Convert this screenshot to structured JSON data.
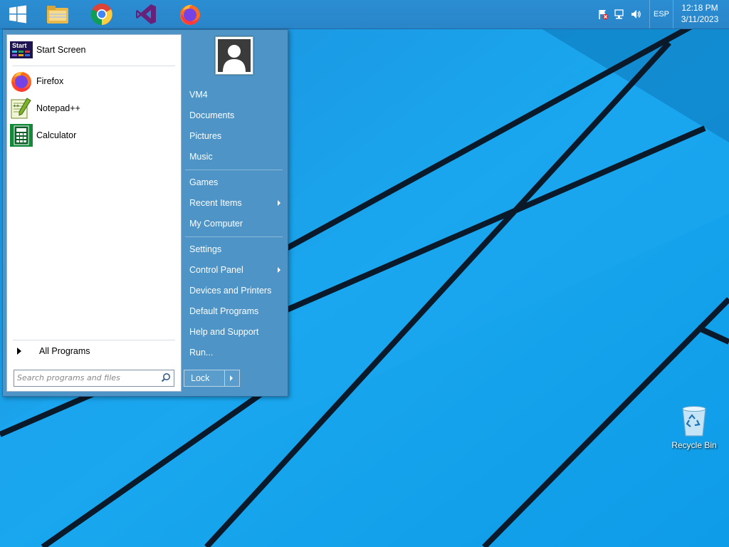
{
  "taskbar": {
    "pinned": [
      {
        "icon": "windows-logo-icon"
      },
      {
        "icon": "file-explorer-icon"
      },
      {
        "icon": "chrome-icon"
      },
      {
        "icon": "visual-studio-icon"
      },
      {
        "icon": "firefox-icon"
      }
    ],
    "tray": {
      "icons": [
        "action-center-flag-icon",
        "network-icon",
        "volume-icon"
      ],
      "language": "ESP",
      "time": "12:18 PM",
      "date": "3/11/2023"
    }
  },
  "start_menu": {
    "programs": [
      {
        "label": "Start Screen",
        "icon": "start-screen-icon"
      },
      {
        "label": "Firefox",
        "icon": "firefox-icon"
      },
      {
        "label": "Notepad++",
        "icon": "notepadpp-icon"
      },
      {
        "label": "Calculator",
        "icon": "calculator-icon"
      }
    ],
    "all_programs": "All Programs",
    "search_placeholder": "Search programs and files",
    "right_items": [
      {
        "label": "VM4"
      },
      {
        "label": "Documents"
      },
      {
        "label": "Pictures"
      },
      {
        "label": "Music"
      },
      {
        "label": "Games"
      },
      {
        "label": "Recent Items",
        "submenu": true
      },
      {
        "label": "My Computer"
      },
      {
        "label": "Settings"
      },
      {
        "label": "Control Panel",
        "submenu": true
      },
      {
        "label": "Devices and Printers"
      },
      {
        "label": "Default Programs"
      },
      {
        "label": "Help and Support"
      },
      {
        "label": "Run..."
      }
    ],
    "lock_label": "Lock"
  },
  "desktop": {
    "icons": [
      {
        "label": "Recycle Bin",
        "icon": "recycle-bin-icon"
      }
    ]
  }
}
